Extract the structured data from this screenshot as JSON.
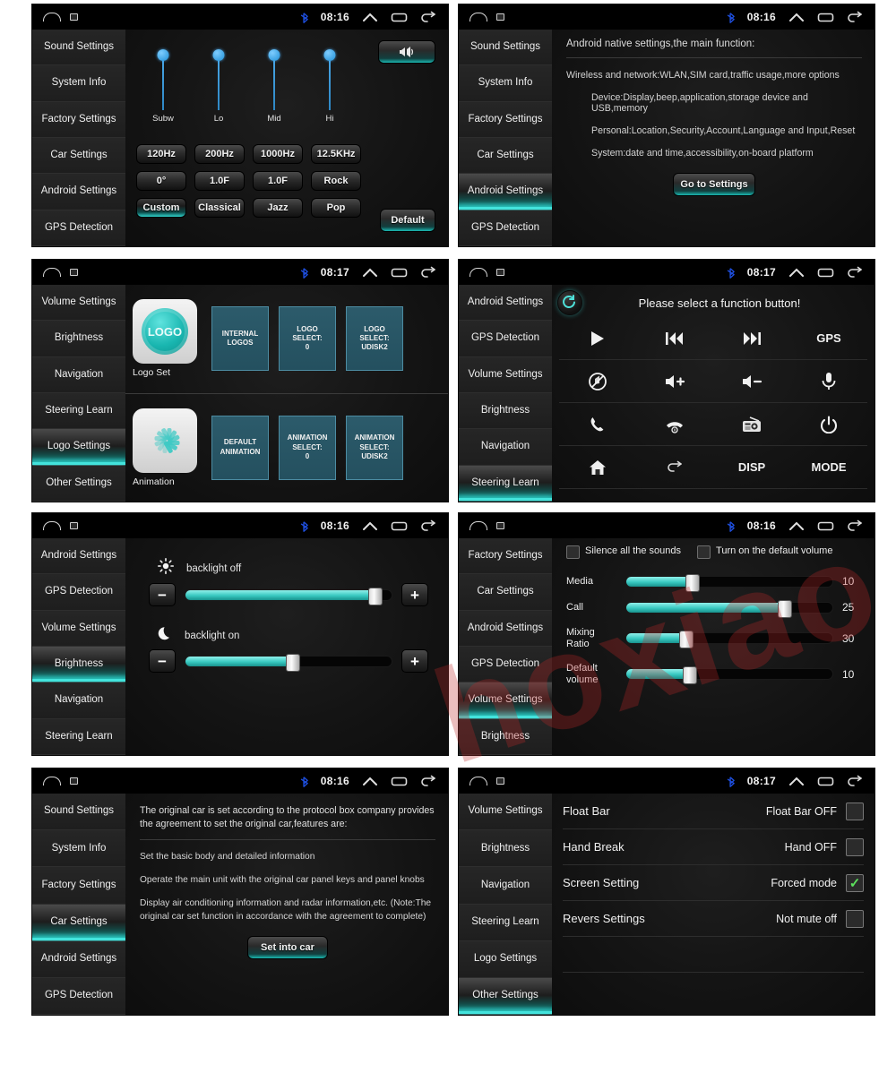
{
  "statusbar": {
    "time_0816": "08:16",
    "time_0817": "08:17",
    "icons": [
      "home-icon",
      "screenshot-icon",
      "bluetooth-icon",
      "chevron-up-icon",
      "recents-icon",
      "back-icon"
    ]
  },
  "watermark": {
    "text": "hoxiao"
  },
  "colors": {
    "accent_teal": "#2fd4cc",
    "tile_blue": "#2c5b6b",
    "tile_border": "#4d8ca2",
    "slider_fill": "#38c8c0",
    "check_green": "#5ce05c",
    "sidebar_bg": "#232323"
  },
  "panels": [
    {
      "id": "sound-settings",
      "sidebar": [
        {
          "label": "Sound Settings",
          "active": false
        },
        {
          "label": "System Info",
          "active": false
        },
        {
          "label": "Factory Settings",
          "active": false
        },
        {
          "label": "Car Settings",
          "active": false
        },
        {
          "label": "Android Settings",
          "active": false
        },
        {
          "label": "GPS Detection",
          "active": false
        }
      ],
      "equalizer": {
        "bands": [
          {
            "label": "Subw",
            "freq": "120Hz",
            "value": "0°"
          },
          {
            "label": "Lo",
            "freq": "200Hz",
            "value": "1.0F"
          },
          {
            "label": "Mid",
            "freq": "1000Hz",
            "value": "1.0F"
          },
          {
            "label": "Hi",
            "freq": "12.5KHz",
            "value": "Rock"
          }
        ],
        "presets": [
          {
            "label": "Custom",
            "active": true
          },
          {
            "label": "Classical",
            "active": false
          },
          {
            "label": "Jazz",
            "active": false
          },
          {
            "label": "Pop",
            "active": false
          }
        ],
        "balance_button": "balance-icon",
        "default_button": "Default"
      }
    },
    {
      "id": "android-settings",
      "sidebar": [
        {
          "label": "Sound Settings",
          "active": false
        },
        {
          "label": "System Info",
          "active": false
        },
        {
          "label": "Factory Settings",
          "active": false
        },
        {
          "label": "Car Settings",
          "active": false
        },
        {
          "label": "Android Settings",
          "active": true
        },
        {
          "label": "GPS Detection",
          "active": false
        }
      ],
      "heading": "Android native settings,the main function:",
      "lines": [
        "Wireless and network:WLAN,SIM card,traffic usage,more options",
        "Device:Display,beep,application,storage device and USB,memory",
        "Personal:Location,Security,Account,Language and Input,Reset",
        "System:date and time,accessibility,on-board platform"
      ],
      "button": "Go to Settings"
    },
    {
      "id": "logo-settings",
      "sidebar": [
        {
          "label": "Volume Settings",
          "active": false
        },
        {
          "label": "Brightness",
          "active": false
        },
        {
          "label": "Navigation",
          "active": false
        },
        {
          "label": "Steering Learn",
          "active": false
        },
        {
          "label": "Logo Settings",
          "active": true
        },
        {
          "label": "Other Settings",
          "active": false
        }
      ],
      "rows": [
        {
          "caption": "Logo Set",
          "thumb": "logo-icon",
          "tiles": [
            "INTERNAL LOGOS",
            "LOGO SELECT:\n0",
            "LOGO SELECT:\nUDISK2"
          ]
        },
        {
          "caption": "Animation",
          "thumb": "spinner-icon",
          "tiles": [
            "DEFAULT\nANIMATION",
            "ANIMATION\nSELECT:\n0",
            "ANIMATION\nSELECT:\nUDISK2"
          ]
        }
      ]
    },
    {
      "id": "steering-learn",
      "sidebar": [
        {
          "label": "Android Settings",
          "active": false
        },
        {
          "label": "GPS Detection",
          "active": false
        },
        {
          "label": "Volume Settings",
          "active": false
        },
        {
          "label": "Brightness",
          "active": false
        },
        {
          "label": "Navigation",
          "active": false
        },
        {
          "label": "Steering Learn",
          "active": true
        }
      ],
      "title": "Please select a function button!",
      "refresh": "refresh-icon",
      "buttons": [
        {
          "icon": "play-icon",
          "text": ""
        },
        {
          "icon": "previous-track-icon",
          "text": ""
        },
        {
          "icon": "next-track-icon",
          "text": ""
        },
        {
          "icon": "",
          "text": "GPS"
        },
        {
          "icon": "mute-icon",
          "text": ""
        },
        {
          "icon": "volume-up-icon",
          "text": ""
        },
        {
          "icon": "volume-down-icon",
          "text": ""
        },
        {
          "icon": "microphone-icon",
          "text": ""
        },
        {
          "icon": "phone-answer-icon",
          "text": ""
        },
        {
          "icon": "phone-hangup-icon",
          "text": ""
        },
        {
          "icon": "radio-icon",
          "text": ""
        },
        {
          "icon": "power-icon",
          "text": ""
        },
        {
          "icon": "home-icon",
          "text": ""
        },
        {
          "icon": "back-icon",
          "text": ""
        },
        {
          "icon": "",
          "text": "DISP"
        },
        {
          "icon": "",
          "text": "MODE"
        }
      ]
    },
    {
      "id": "brightness",
      "sidebar": [
        {
          "label": "Android Settings",
          "active": false
        },
        {
          "label": "GPS Detection",
          "active": false
        },
        {
          "label": "Volume Settings",
          "active": false
        },
        {
          "label": "Brightness",
          "active": true
        },
        {
          "label": "Navigation",
          "active": false
        },
        {
          "label": "Steering Learn",
          "active": false
        }
      ],
      "groups": [
        {
          "icon": "sun-icon",
          "label": "backlight off",
          "percent": 92,
          "minus": "−",
          "plus": "+"
        },
        {
          "icon": "moon-icon",
          "label": "backlight on",
          "percent": 52,
          "minus": "−",
          "plus": "+"
        }
      ]
    },
    {
      "id": "volume-settings",
      "sidebar": [
        {
          "label": "Factory Settings",
          "active": false
        },
        {
          "label": "Car Settings",
          "active": false
        },
        {
          "label": "Android Settings",
          "active": false
        },
        {
          "label": "GPS Detection",
          "active": false
        },
        {
          "label": "Volume Settings",
          "active": true
        },
        {
          "label": "Brightness",
          "active": false
        }
      ],
      "checkboxes": [
        {
          "label": "Silence all the sounds",
          "checked": false
        },
        {
          "label": "Turn on the default volume",
          "checked": false
        }
      ],
      "sliders": [
        {
          "name": "Media",
          "value": "10",
          "percent": 32
        },
        {
          "name": "Call",
          "value": "25",
          "percent": 77
        },
        {
          "name": "Mixing Ratio",
          "value": "30",
          "percent": 29
        },
        {
          "name": "Default volume",
          "value": "10",
          "percent": 31
        }
      ]
    },
    {
      "id": "car-settings",
      "sidebar": [
        {
          "label": "Sound Settings",
          "active": false
        },
        {
          "label": "System Info",
          "active": false
        },
        {
          "label": "Factory Settings",
          "active": false
        },
        {
          "label": "Car Settings",
          "active": true
        },
        {
          "label": "Android Settings",
          "active": false
        },
        {
          "label": "GPS Detection",
          "active": false
        }
      ],
      "heading": "The original car is set according to the protocol box company provides the agreement to set the original car,features are:",
      "paragraphs": [
        "Set the basic body and detailed information",
        "Operate the main unit with the original car panel keys and panel knobs",
        "Display air conditioning information and radar information,etc. (Note:The original car set function in accordance with the agreement to complete)"
      ],
      "button": "Set into car"
    },
    {
      "id": "other-settings",
      "sidebar": [
        {
          "label": "Volume Settings",
          "active": false
        },
        {
          "label": "Brightness",
          "active": false
        },
        {
          "label": "Navigation",
          "active": false
        },
        {
          "label": "Steering Learn",
          "active": false
        },
        {
          "label": "Logo Settings",
          "active": false
        },
        {
          "label": "Other Settings",
          "active": true
        }
      ],
      "rows": [
        {
          "name": "Float Bar",
          "value": "Float Bar OFF",
          "checked": false
        },
        {
          "name": "Hand Break",
          "value": "Hand OFF",
          "checked": false
        },
        {
          "name": "Screen Setting",
          "value": "Forced mode",
          "checked": true
        },
        {
          "name": "Revers Settings",
          "value": "Not mute off",
          "checked": false
        }
      ]
    }
  ]
}
